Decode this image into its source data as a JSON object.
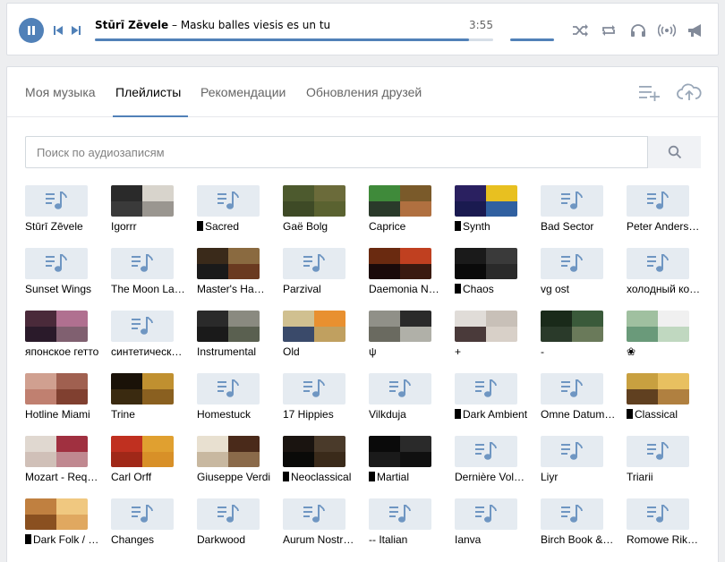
{
  "player": {
    "artist": "Stūrī Zēvele",
    "separator": " – ",
    "title": "Masku balles viesis es un tu",
    "duration": "3:55",
    "progress_fraction": 0.94,
    "volume_fraction": 1.0,
    "accent": "#5181b8",
    "controls": [
      "pause-icon",
      "prev-icon",
      "next-icon",
      "shuffle-icon",
      "repeat-icon",
      "headphones-icon",
      "broadcast-icon",
      "megaphone-icon"
    ]
  },
  "tabs": [
    {
      "label": "Моя музыка",
      "active": false
    },
    {
      "label": "Плейлисты",
      "active": true
    },
    {
      "label": "Рекомендации",
      "active": false
    },
    {
      "label": "Обновления друзей",
      "active": false
    }
  ],
  "search": {
    "placeholder": "Поиск по аудиозаписям"
  },
  "playlists": [
    {
      "label": "Stūrī Zēvele",
      "cover": "default",
      "marker": false
    },
    {
      "label": "Igorrr",
      "cover": [
        "#2a2a2a",
        "#d8d4cc",
        "#3a3a3a",
        "#9a9690"
      ],
      "marker": false
    },
    {
      "label": "Sacred",
      "cover": "default",
      "marker": true
    },
    {
      "label": "Gaë Bolg",
      "cover": [
        "#4d5a2e",
        "#6b6b3a",
        "#3e4a26",
        "#5a6230"
      ],
      "marker": false
    },
    {
      "label": "Caprice",
      "cover": [
        "#3f8a3a",
        "#7a5a2a",
        "#2a3a2a",
        "#b07040"
      ],
      "marker": false
    },
    {
      "label": "Synth",
      "cover": [
        "#2a2060",
        "#e8c020",
        "#1a1a50",
        "#3060a0"
      ],
      "marker": true
    },
    {
      "label": "Bad Sector",
      "cover": "default",
      "marker": false
    },
    {
      "label": "Peter Anderss…",
      "cover": "default",
      "marker": false
    },
    {
      "label": "Sunset Wings",
      "cover": "default",
      "marker": false
    },
    {
      "label": "The Moon Lay…",
      "cover": "default",
      "marker": false
    },
    {
      "label": "Master's Ham…",
      "cover": [
        "#3a2a1a",
        "#8a6a40",
        "#1a1a1a",
        "#6a3a20"
      ],
      "marker": false
    },
    {
      "label": "Parzival",
      "cover": "default",
      "marker": false
    },
    {
      "label": "Daemonia Ny…",
      "cover": [
        "#6a2a10",
        "#c04020",
        "#1a0a0a",
        "#3a1a10"
      ],
      "marker": false
    },
    {
      "label": "Chaos",
      "cover": [
        "#1a1a1a",
        "#3a3a3a",
        "#0a0a0a",
        "#2a2a2a"
      ],
      "marker": true
    },
    {
      "label": "vg ost",
      "cover": "default",
      "marker": false
    },
    {
      "label": "холодный ко…",
      "cover": "default",
      "marker": false
    },
    {
      "label": "японское гетто",
      "cover": [
        "#4a2a3a",
        "#b07090",
        "#2a1a2a",
        "#806070"
      ],
      "marker": false
    },
    {
      "label": "синтетически…",
      "cover": "default",
      "marker": false
    },
    {
      "label": "Instrumental",
      "cover": [
        "#2a2a2a",
        "#8a8a80",
        "#1a1a1a",
        "#5a6050"
      ],
      "marker": false
    },
    {
      "label": "Old",
      "cover": [
        "#d0c090",
        "#e89030",
        "#3a4a6a",
        "#c0a060"
      ],
      "marker": false
    },
    {
      "label": "ψ",
      "cover": [
        "#909088",
        "#2a2a2a",
        "#6a6a60",
        "#b0b0a8"
      ],
      "marker": false
    },
    {
      "label": "+",
      "cover": [
        "#e0dcd8",
        "#c8c0b8",
        "#4a3a3a",
        "#d8d0c8"
      ],
      "marker": false
    },
    {
      "label": "-",
      "cover": [
        "#1a2a1a",
        "#3a5a3a",
        "#2a3a2a",
        "#6a7a5a"
      ],
      "marker": false
    },
    {
      "label": "❀",
      "cover": [
        "#a0c0a0",
        "#f0f0f0",
        "#6a9a7a",
        "#c0d8c0"
      ],
      "marker": false
    },
    {
      "label": "Hotline Miami",
      "cover": [
        "#d0a090",
        "#a06050",
        "#c08070",
        "#804030"
      ],
      "marker": false
    },
    {
      "label": "Trine",
      "cover": [
        "#1a1208",
        "#c09030",
        "#3a2a10",
        "#8a6020"
      ],
      "marker": false
    },
    {
      "label": "Homestuck",
      "cover": "default",
      "marker": false
    },
    {
      "label": "17 Hippies",
      "cover": "default",
      "marker": false
    },
    {
      "label": "Vilkduja",
      "cover": "default",
      "marker": false
    },
    {
      "label": "Dark Ambient",
      "cover": "default",
      "marker": true
    },
    {
      "label": "Omne Datum …",
      "cover": "default",
      "marker": false
    },
    {
      "label": "Classical",
      "cover": [
        "#c8a040",
        "#e8c060",
        "#604020",
        "#b08040"
      ],
      "marker": true
    },
    {
      "label": "Mozart - Requi…",
      "cover": [
        "#e0d8d0",
        "#a03040",
        "#d0c0b8",
        "#c08890"
      ],
      "marker": false
    },
    {
      "label": "Carl Orff",
      "cover": [
        "#c03020",
        "#e0a030",
        "#a02818",
        "#d89028"
      ],
      "marker": false
    },
    {
      "label": "Giuseppe Verdi",
      "cover": [
        "#e8e0d0",
        "#4a2a1a",
        "#c8b8a0",
        "#8a6a4a"
      ],
      "marker": false
    },
    {
      "label": "Neoclassical",
      "cover": [
        "#1a1410",
        "#4a3a2a",
        "#0a0a08",
        "#3a2a1a"
      ],
      "marker": true
    },
    {
      "label": "Martial",
      "cover": [
        "#0a0a0a",
        "#2a2a2a",
        "#1a1a1a",
        "#101010"
      ],
      "marker": true
    },
    {
      "label": "Dernière Volo…",
      "cover": "default",
      "marker": false
    },
    {
      "label": "Liyr",
      "cover": "default",
      "marker": false
    },
    {
      "label": "Triarii",
      "cover": "default",
      "marker": false
    },
    {
      "label": "Dark Folk / …",
      "cover": [
        "#c08040",
        "#f0c880",
        "#8a5020",
        "#e0a860"
      ],
      "marker": true
    },
    {
      "label": "Changes",
      "cover": "default",
      "marker": false
    },
    {
      "label": "Darkwood",
      "cover": "default",
      "marker": false
    },
    {
      "label": "Aurum Nostrum",
      "cover": "default",
      "marker": false
    },
    {
      "label": "-- Italian",
      "cover": "default",
      "marker": false
    },
    {
      "label": "Ianva",
      "cover": "default",
      "marker": false
    },
    {
      "label": "Birch Book & I…",
      "cover": "default",
      "marker": false
    },
    {
      "label": "Romowe Rikoi…",
      "cover": "default",
      "marker": false
    }
  ]
}
